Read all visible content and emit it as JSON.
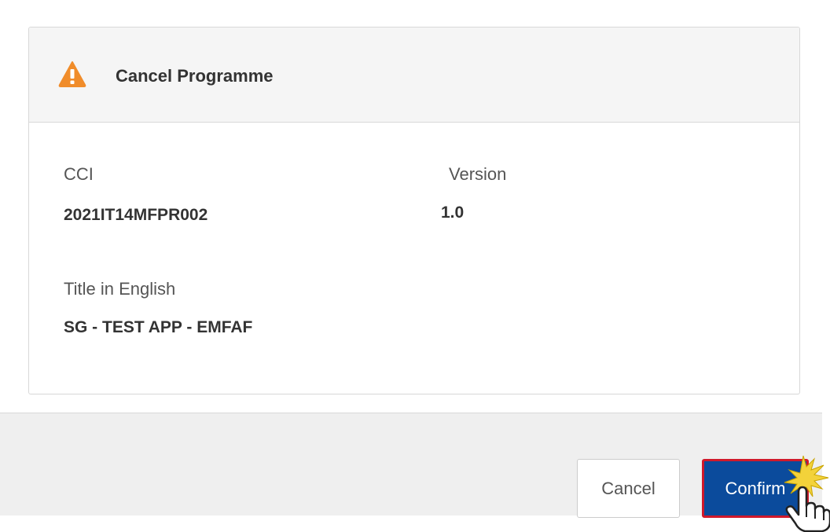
{
  "dialog": {
    "title": "Cancel Programme",
    "fields": {
      "cci_label": "CCI",
      "cci_value": "2021IT14MFPR002",
      "version_label": "Version",
      "version_value": "1.0",
      "title_label": "Title in English",
      "title_value": "SG - TEST APP - EMFAF"
    }
  },
  "footer": {
    "cancel_label": "Cancel",
    "confirm_label": "Confirm"
  },
  "icons": {
    "warning": "warning-triangle-icon",
    "cursor": "hand-pointer-click-icon"
  },
  "colors": {
    "warning": "#f08c2a",
    "confirm_bg": "#0b4b9c",
    "confirm_border": "#d0192b",
    "header_bg": "#f5f5f5",
    "footer_bg": "#efefef"
  }
}
